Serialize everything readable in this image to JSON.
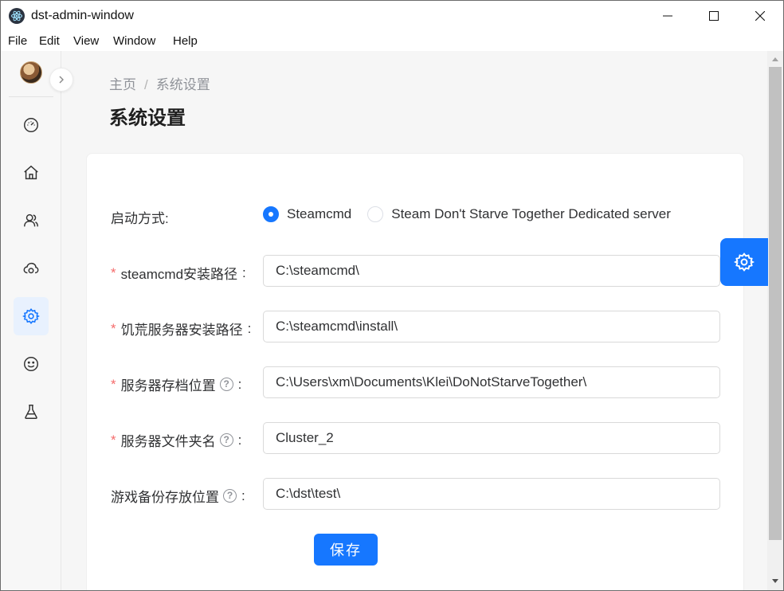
{
  "window": {
    "title": "dst-admin-window",
    "icon": "electron-app-icon"
  },
  "menubar": {
    "items": [
      "File",
      "Edit",
      "View",
      "Window",
      "Help"
    ]
  },
  "sidebar": {
    "items": [
      {
        "icon": "dashboard-icon",
        "active": false
      },
      {
        "icon": "home-icon",
        "active": false
      },
      {
        "icon": "users-icon",
        "active": false
      },
      {
        "icon": "cloud-icon",
        "active": false
      },
      {
        "icon": "settings-icon",
        "active": true
      },
      {
        "icon": "smile-icon",
        "active": false
      },
      {
        "icon": "flask-icon",
        "active": false
      }
    ]
  },
  "breadcrumb": {
    "home": "主页",
    "separator": "/",
    "current": "系统设置"
  },
  "page": {
    "title": "系统设置"
  },
  "form": {
    "launch_mode": {
      "label": "启动方式:",
      "options": [
        "Steamcmd",
        "Steam Don't Starve Together Dedicated server"
      ],
      "selected": "Steamcmd"
    },
    "steamcmd_path": {
      "label": "steamcmd安装路径",
      "value": "C:\\steamcmd\\",
      "required": true
    },
    "server_install_path": {
      "label": "饥荒服务器安装路径",
      "value": "C:\\steamcmd\\install\\",
      "required": true
    },
    "save_location": {
      "label": "服务器存档位置",
      "value": "C:\\Users\\xm\\Documents\\Klei\\DoNotStarveTogether\\",
      "required": true
    },
    "folder_name": {
      "label": "服务器文件夹名",
      "value": "Cluster_2",
      "required": true
    },
    "backup_location": {
      "label": "游戏备份存放位置",
      "value": "C:\\dst\\test\\",
      "required": false
    },
    "colon": ":",
    "save_label": "保存"
  },
  "colors": {
    "primary": "#1677ff",
    "required": "#f56c6c",
    "background": "#f6f6f6"
  }
}
